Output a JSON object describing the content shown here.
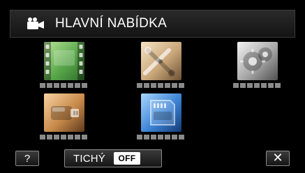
{
  "header": {
    "title": "HLAVNÍ NABÍDKA",
    "icon": "camcorder-icon"
  },
  "menu": {
    "items": [
      {
        "icon": "film-strip-icon"
      },
      {
        "icon": "scissors-icon"
      },
      {
        "icon": "gears-icon"
      },
      {
        "icon": "usb-drive-icon"
      },
      {
        "icon": "sd-card-icon"
      }
    ]
  },
  "bottom": {
    "help_label": "?",
    "silent_label": "TICHÝ",
    "silent_state": "OFF",
    "close_label": "✕"
  }
}
